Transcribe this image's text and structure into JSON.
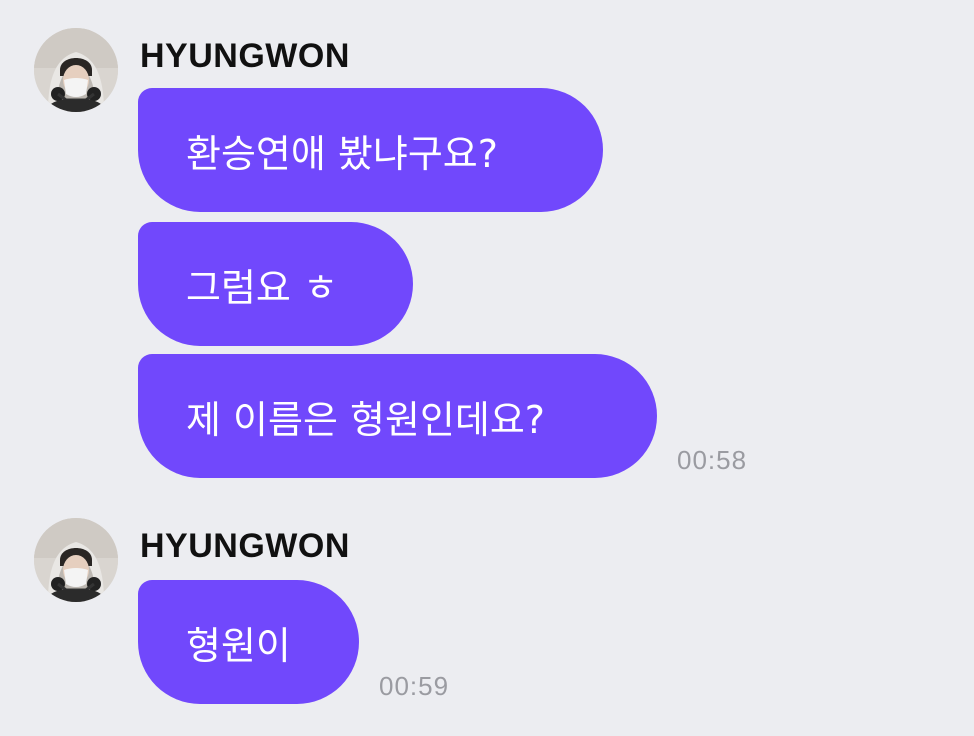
{
  "messages": [
    {
      "sender": "HYUNGWON",
      "bubbles": [
        "환승연애 봤냐구요?",
        "그럼요 ㅎ",
        "제 이름은 형원인데요?"
      ],
      "time": "00:58"
    },
    {
      "sender": "HYUNGWON",
      "bubbles": [
        "형원이"
      ],
      "time": "00:59"
    }
  ],
  "colors": {
    "background": "#ECEDF1",
    "bubble": "#7148FC",
    "bubble_text": "#FFFFFF",
    "timestamp": "#9A9BA1"
  },
  "icons": {
    "avatar": "profile-photo-masked-person"
  }
}
